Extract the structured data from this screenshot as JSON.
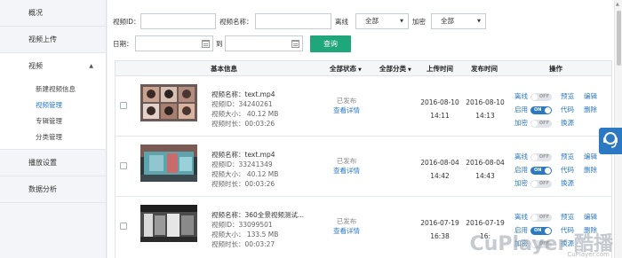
{
  "sidebar": {
    "items": [
      {
        "label": "概况"
      },
      {
        "label": "视频上传"
      },
      {
        "label": "视频"
      },
      {
        "label": "播放设置"
      },
      {
        "label": "数据分析"
      }
    ],
    "video_submenu": [
      {
        "label": "新建视频信息"
      },
      {
        "label": "视频管理"
      },
      {
        "label": "专辑管理"
      },
      {
        "label": "分类管理"
      }
    ]
  },
  "filters": {
    "video_id_label": "视频ID：",
    "video_name_label": "视频名称：",
    "offline_label": "离线",
    "offline_value": "全部",
    "encrypt_label": "加密",
    "encrypt_value": "全部",
    "date_label": "日期：",
    "to_label": "到",
    "query_label": "查询"
  },
  "table": {
    "headers": {
      "basic_info": "基本信息",
      "all_status": "全部状态",
      "all_category": "全部分类",
      "upload_time": "上传时间",
      "publish_time": "发布时间",
      "operation": "操作"
    },
    "rows": [
      {
        "name": "视频名称：text.mp4",
        "id": "视频ID：34240261",
        "size": "视频大小： 40.12 MB",
        "duration": "视频时长：00:03:26",
        "status": "已发布",
        "detail": "查看详情",
        "upload_date": "2016-08-10",
        "upload_time": "14:11",
        "publish_date": "2016-08-10",
        "publish_time": "14:13"
      },
      {
        "name": "视频名称：text.mp4",
        "id": "视频ID：33241349",
        "size": "视频大小： 40.12 MB",
        "duration": "视频时长：00:03:26",
        "status": "已发布",
        "detail": "查看详情",
        "upload_date": "2016-08-04",
        "upload_time": "14:42",
        "publish_date": "2016-08-04",
        "publish_time": "14:43"
      },
      {
        "name": "视频名称：360全景视频测试...",
        "id": "视频ID：33099501",
        "size": "视频大小： 133.5 MB",
        "duration": "视频时长：00:03:27",
        "status": "已发布",
        "detail": "查看详情",
        "upload_date": "2016-07-19",
        "upload_time": "16:38",
        "publish_date": "2016-07-19",
        "publish_time": "16:"
      }
    ],
    "ops": {
      "offline": "离线",
      "enable": "启用",
      "encrypt": "加密",
      "on": "ON",
      "off": "OFF",
      "preview": "预览",
      "code": "代码",
      "replace": "换源",
      "edit": "编辑",
      "delete": "删除"
    }
  },
  "watermark": {
    "text": "CuPlayer 酷播",
    "sub": "CuPlayer.com"
  },
  "colors": {
    "accent": "#2b79c2",
    "query_button": "#1fa67a"
  }
}
